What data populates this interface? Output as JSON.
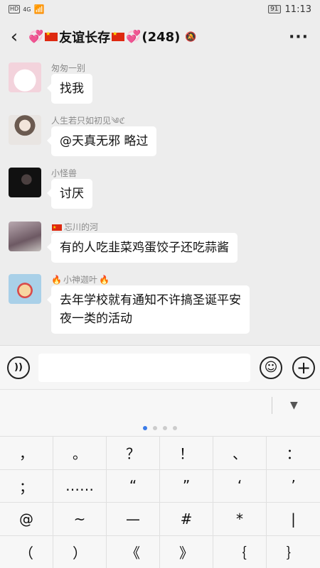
{
  "status_bar": {
    "hd": "HD",
    "network": "4G",
    "battery": "91",
    "time": "11:13"
  },
  "chat": {
    "title_text": "友谊长存",
    "member_count": "(248)",
    "back_icon": "back-arrow-icon",
    "more_icon": "more-icon"
  },
  "messages": [
    {
      "nickname": "匆匆一别",
      "text": "找我"
    },
    {
      "nickname": "人生若只如初见༄ℭ",
      "text": "@天真无邪  略过"
    },
    {
      "nickname": "小怪兽",
      "text": "讨厌"
    },
    {
      "nickname": "忘川的河",
      "text": "有的人吃韭菜鸡蛋饺子还吃蒜酱"
    },
    {
      "nickname": "小神迦叶",
      "text_line1": "去年学校就有通知不许搞圣诞平安",
      "text_line2": "夜一类的活动"
    }
  ],
  "input": {
    "placeholder": ""
  },
  "keyboard": {
    "keys": [
      "，",
      "。",
      "？",
      "！",
      "、",
      "：",
      "；",
      "……",
      "“",
      "”",
      "‘",
      "’",
      "@",
      "~",
      "—",
      "#",
      "*",
      "|",
      "（",
      "）",
      "《",
      "》",
      "｛",
      "｝"
    ],
    "page_count": 4,
    "active_page": 0
  },
  "colors": {
    "background": "#ededed",
    "bubble": "#ffffff",
    "accent_dot": "#3a7be8"
  }
}
